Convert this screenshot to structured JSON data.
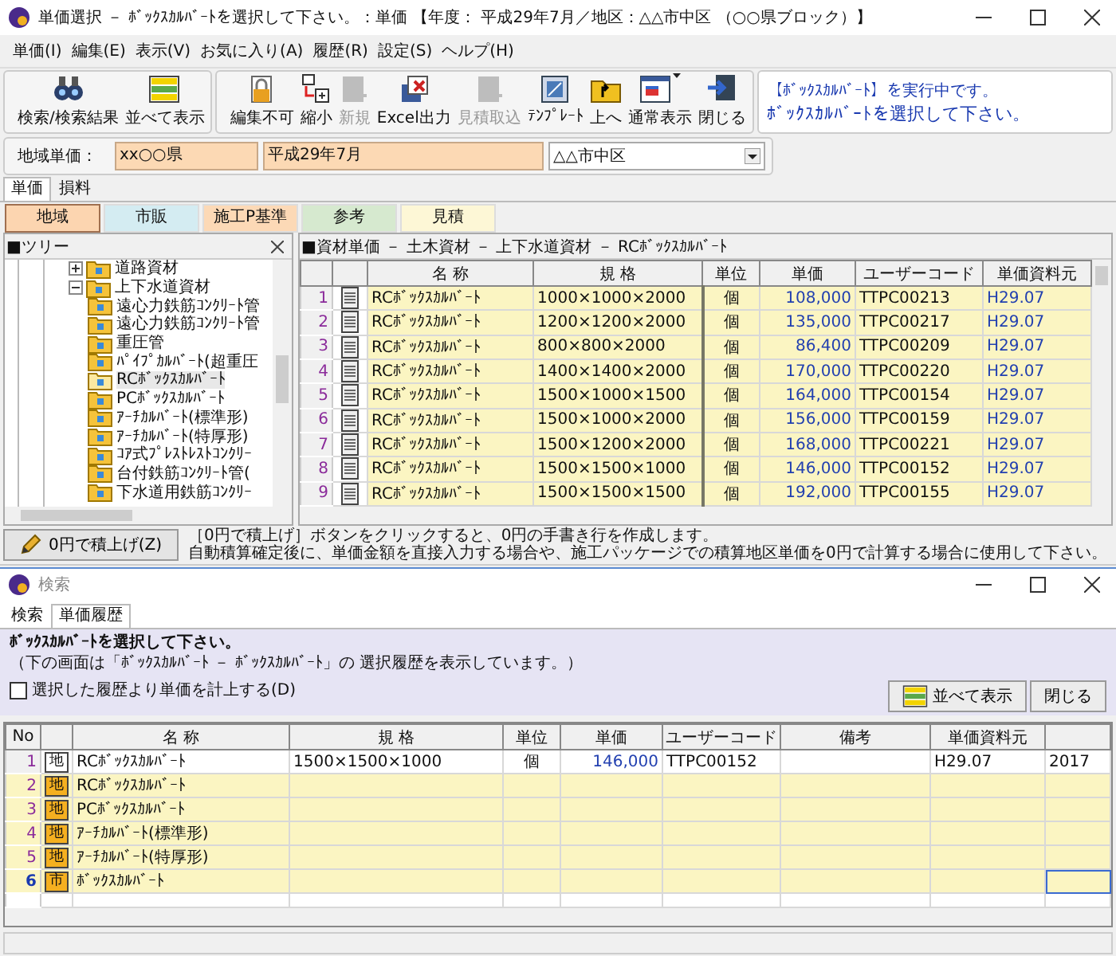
{
  "window": {
    "title": "単価選択 － ﾎﾞｯｸｽｶﾙﾊﾞｰﾄを選択して下さい。：単価 【年度： 平成29年7月／地区：△△市中区 （○○県ブロック）】"
  },
  "menu": [
    "単価(I)",
    "編集(E)",
    "表示(V)",
    "お気に入り(A)",
    "履歴(R)",
    "設定(S)",
    "ヘルプ(H)"
  ],
  "toolbar_groups": [
    [
      {
        "label": "検索/検索結果",
        "kind": "search",
        "disabled": false
      },
      {
        "label": "並べて表示",
        "kind": "side-by-side",
        "disabled": false
      }
    ],
    [
      {
        "label": "編集不可",
        "kind": "lock",
        "disabled": false
      },
      {
        "label": "縮小",
        "kind": "shrink",
        "disabled": false
      },
      {
        "label": "新規",
        "kind": "new",
        "disabled": true
      },
      {
        "label": "Excel出力",
        "kind": "excel",
        "disabled": false
      },
      {
        "label": "見積取込",
        "kind": "import",
        "disabled": true
      },
      {
        "label": "ﾃﾝﾌﾟﾚｰﾄ",
        "kind": "template",
        "disabled": false
      },
      {
        "label": "上へ",
        "kind": "up",
        "disabled": false
      },
      {
        "label": "通常表示",
        "kind": "view",
        "disabled": false,
        "dropdown": true
      },
      {
        "label": "閉じる",
        "kind": "exit",
        "disabled": false
      }
    ]
  ],
  "message": {
    "line_1": "【ﾎﾞｯｸｽｶﾙﾊﾞｰﾄ】を実行中です。",
    "line_2": "ﾎﾞｯｸｽｶﾙﾊﾞｰﾄを選択して下さい。"
  },
  "region": {
    "label": "地域単価：",
    "prefecture": "xx○○県",
    "period": "平成29年7月",
    "district": "△△市中区"
  },
  "tabs": [
    {
      "label": "単価",
      "selected": true
    },
    {
      "label": "損料",
      "selected": false
    }
  ],
  "categories": [
    {
      "label": "地域",
      "color": "#fcd5b0",
      "selected": true
    },
    {
      "label": "市販",
      "color": "#d4ecf2",
      "selected": false
    },
    {
      "label": "施工P基準",
      "color": "#fcd9b6",
      "selected": false
    },
    {
      "label": "参考",
      "color": "#d6e9cf",
      "selected": false
    },
    {
      "label": "見積",
      "color": "#fdf7d6",
      "selected": false
    }
  ],
  "tree": {
    "title": "■ツリー",
    "items": [
      {
        "label": "道路資材",
        "expanded": false,
        "selected": false
      },
      {
        "label": "上下水道資材",
        "expanded": true,
        "selected": false,
        "children": [
          {
            "label": "遠心力鉄筋ｺﾝｸﾘｰﾄ管",
            "selected": false
          },
          {
            "label": "遠心力鉄筋ｺﾝｸﾘｰﾄ管",
            "selected": false
          },
          {
            "label": "重圧管",
            "selected": false
          },
          {
            "label": "ﾊﾟｲﾌﾟｶﾙﾊﾞｰﾄ(超重圧",
            "selected": false
          },
          {
            "label": "RCﾎﾞｯｸｽｶﾙﾊﾞｰﾄ",
            "selected": true
          },
          {
            "label": "PCﾎﾞｯｸｽｶﾙﾊﾞｰﾄ",
            "selected": false
          },
          {
            "label": "ｱｰﾁｶﾙﾊﾞｰﾄ(標準形)",
            "selected": false
          },
          {
            "label": "ｱｰﾁｶﾙﾊﾞｰﾄ(特厚形)",
            "selected": false
          },
          {
            "label": "ｺｱ式ﾌﾟﾚｽﾄﾚｽﾄｺﾝｸﾘｰ",
            "selected": false
          },
          {
            "label": "台付鉄筋ｺﾝｸﾘｰﾄ管(",
            "selected": false
          },
          {
            "label": "下水道用鉄筋ｺﾝｸﾘｰ",
            "selected": false
          }
        ]
      }
    ]
  },
  "table": {
    "title": "■資材単価 － 土木資材 － 上下水道資材 － RCﾎﾞｯｸｽｶﾙﾊﾞｰﾄ",
    "columns": [
      "名 称",
      "規 格",
      "単位",
      "単価",
      "ユーザーコード",
      "単価資料元"
    ],
    "rows": [
      {
        "no": "1",
        "name": "RCﾎﾞｯｸｽｶﾙﾊﾞｰﾄ",
        "spec": "1000×1000×2000",
        "unit": "個",
        "price": "108,000",
        "code": "TTPC00213",
        "source": "H29.07"
      },
      {
        "no": "2",
        "name": "RCﾎﾞｯｸｽｶﾙﾊﾞｰﾄ",
        "spec": "1200×1200×2000",
        "unit": "個",
        "price": "135,000",
        "code": "TTPC00217",
        "source": "H29.07"
      },
      {
        "no": "3",
        "name": "RCﾎﾞｯｸｽｶﾙﾊﾞｰﾄ",
        "spec": "800×800×2000",
        "unit": "個",
        "price": "86,400",
        "code": "TTPC00209",
        "source": "H29.07"
      },
      {
        "no": "4",
        "name": "RCﾎﾞｯｸｽｶﾙﾊﾞｰﾄ",
        "spec": "1400×1400×2000",
        "unit": "個",
        "price": "170,000",
        "code": "TTPC00220",
        "source": "H29.07"
      },
      {
        "no": "5",
        "name": "RCﾎﾞｯｸｽｶﾙﾊﾞｰﾄ",
        "spec": "1500×1000×1500",
        "unit": "個",
        "price": "164,000",
        "code": "TTPC00154",
        "source": "H29.07"
      },
      {
        "no": "6",
        "name": "RCﾎﾞｯｸｽｶﾙﾊﾞｰﾄ",
        "spec": "1500×1000×2000",
        "unit": "個",
        "price": "156,000",
        "code": "TTPC00159",
        "source": "H29.07"
      },
      {
        "no": "7",
        "name": "RCﾎﾞｯｸｽｶﾙﾊﾞｰﾄ",
        "spec": "1500×1200×2000",
        "unit": "個",
        "price": "168,000",
        "code": "TTPC00221",
        "source": "H29.07"
      },
      {
        "no": "8",
        "name": "RCﾎﾞｯｸｽｶﾙﾊﾞｰﾄ",
        "spec": "1500×1500×1000",
        "unit": "個",
        "price": "146,000",
        "code": "TTPC00152",
        "source": "H29.07"
      },
      {
        "no": "9",
        "name": "RCﾎﾞｯｸｽｶﾙﾊﾞｰﾄ",
        "spec": "1500×1500×1500",
        "unit": "個",
        "price": "192,000",
        "code": "TTPC00155",
        "source": "H29.07"
      }
    ]
  },
  "zero_button": "0円で積上げ(Z)",
  "note": [
    "［0円で積上げ］ボタンをクリックすると、0円の手書き行を作成します。",
    "自動積算確定後に、単価金額を直接入力する場合や、施工パッケージでの積算地区単価を0円で計算する場合に使用して下さい。"
  ],
  "search_window": {
    "title": "検索",
    "tabs": [
      {
        "label": "検索",
        "selected": false
      },
      {
        "label": "単価履歴",
        "selected": true
      }
    ],
    "heading": "ﾎﾞｯｸｽｶﾙﾊﾞｰﾄを選択して下さい。",
    "subtext": "（下の画面は「ﾎﾞｯｸｽｶﾙﾊﾞｰﾄ － ﾎﾞｯｸｽｶﾙﾊﾞｰﾄ」の 選択履歴を表示しています。）",
    "checkbox": {
      "label": "選択した履歴より単価を計上する(D)",
      "checked": false
    },
    "buttons": [
      {
        "label": "並べて表示",
        "kind": "side-by-side"
      },
      {
        "label": "閉じる",
        "kind": "plain"
      }
    ],
    "columns": [
      "No",
      "名 称",
      "規 格",
      "単位",
      "単価",
      "ユーザーコード",
      "備考",
      "単価資料元"
    ],
    "rows": [
      {
        "no": "1",
        "kind": "item",
        "badge": "地",
        "name": "RCﾎﾞｯｸｽｶﾙﾊﾞｰﾄ",
        "spec": "1500×1500×1000",
        "unit": "個",
        "price": "146,000",
        "code": "TTPC00152",
        "source": "H29.07",
        "column_9": "2017",
        "selected": false
      },
      {
        "no": "2",
        "kind": "folder",
        "badge": "地",
        "name": "RCﾎﾞｯｸｽｶﾙﾊﾞｰﾄ",
        "selected": false
      },
      {
        "no": "3",
        "kind": "folder",
        "badge": "地",
        "name": "PCﾎﾞｯｸｽｶﾙﾊﾞｰﾄ",
        "selected": false
      },
      {
        "no": "4",
        "kind": "folder",
        "badge": "地",
        "name": "ｱｰﾁｶﾙﾊﾞｰﾄ(標準形)",
        "selected": false
      },
      {
        "no": "5",
        "kind": "folder",
        "badge": "地",
        "name": "ｱｰﾁｶﾙﾊﾞｰﾄ(特厚形)",
        "selected": false
      },
      {
        "no": "6",
        "kind": "folder",
        "badge": "市",
        "name": "ﾎﾞｯｸｽｶﾙﾊﾞｰﾄ",
        "selected": true
      }
    ]
  }
}
